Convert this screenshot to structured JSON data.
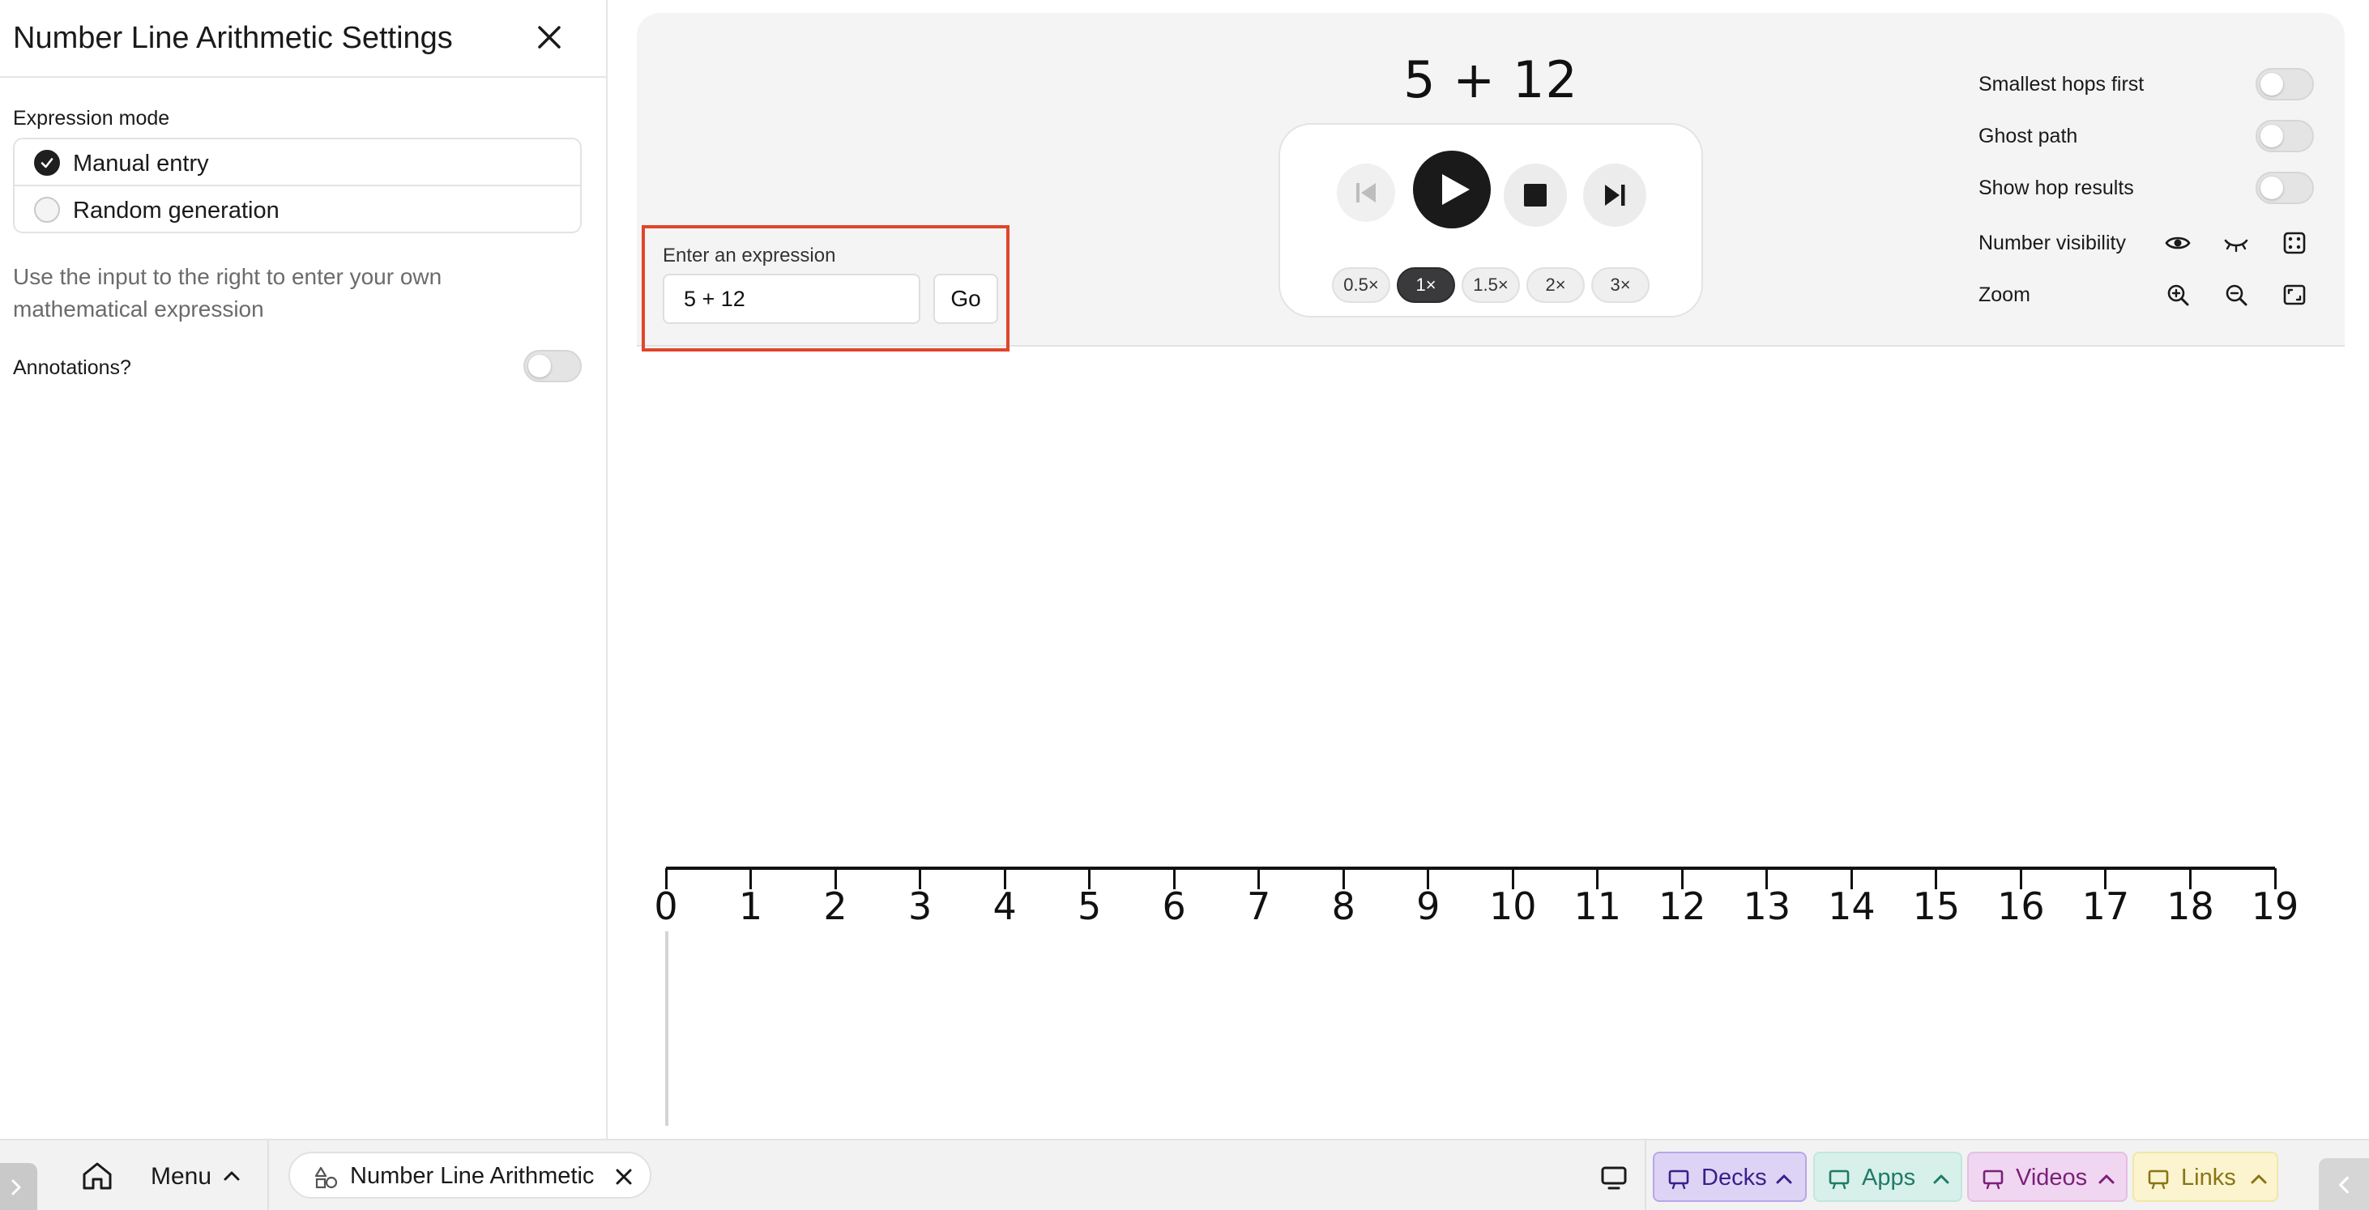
{
  "settings": {
    "title": "Number Line Arithmetic Settings",
    "expression_mode_label": "Expression mode",
    "modes": [
      {
        "label": "Manual entry",
        "selected": true
      },
      {
        "label": "Random generation",
        "selected": false
      }
    ],
    "help_text": "Use the input to the right to enter your own mathematical expression",
    "annotations_label": "Annotations?",
    "annotations_on": false
  },
  "panel": {
    "expression_display": "5 + 12",
    "expression_input_label": "Enter an expression",
    "expression_input_value": "5 + 12",
    "go_label": "Go",
    "speeds": [
      {
        "label": "0.5×",
        "active": false
      },
      {
        "label": "1×",
        "active": true
      },
      {
        "label": "1.5×",
        "active": false
      },
      {
        "label": "2×",
        "active": false
      },
      {
        "label": "3×",
        "active": false
      }
    ],
    "options": {
      "smallest_hops_first": "Smallest hops first",
      "ghost_path": "Ghost path",
      "show_hop_results": "Show hop results",
      "number_visibility": "Number visibility",
      "zoom": "Zoom"
    },
    "toggles": {
      "smallest_hops_first": false,
      "ghost_path": false,
      "show_hop_results": false
    }
  },
  "numberline": {
    "labels": [
      "0",
      "1",
      "2",
      "3",
      "4",
      "5",
      "6",
      "7",
      "8",
      "9",
      "10",
      "11",
      "12",
      "13",
      "14",
      "15",
      "16",
      "17",
      "18",
      "19"
    ]
  },
  "taskbar": {
    "menu_label": "Menu",
    "app_tab_label": "Number Line Arithmetic",
    "decks_label": "Decks",
    "apps_label": "Apps",
    "videos_label": "Videos",
    "links_label": "Links"
  },
  "colors": {
    "highlight_border": "#e0452b",
    "decks_bg": "#ddd4f5",
    "decks_text": "#3b1f8a",
    "apps_bg": "#d7f0ea",
    "apps_text": "#1f7a66",
    "videos_bg": "#f0d6f0",
    "videos_text": "#7a1f7a",
    "links_bg": "#fbf4cf",
    "links_text": "#8a7414"
  }
}
